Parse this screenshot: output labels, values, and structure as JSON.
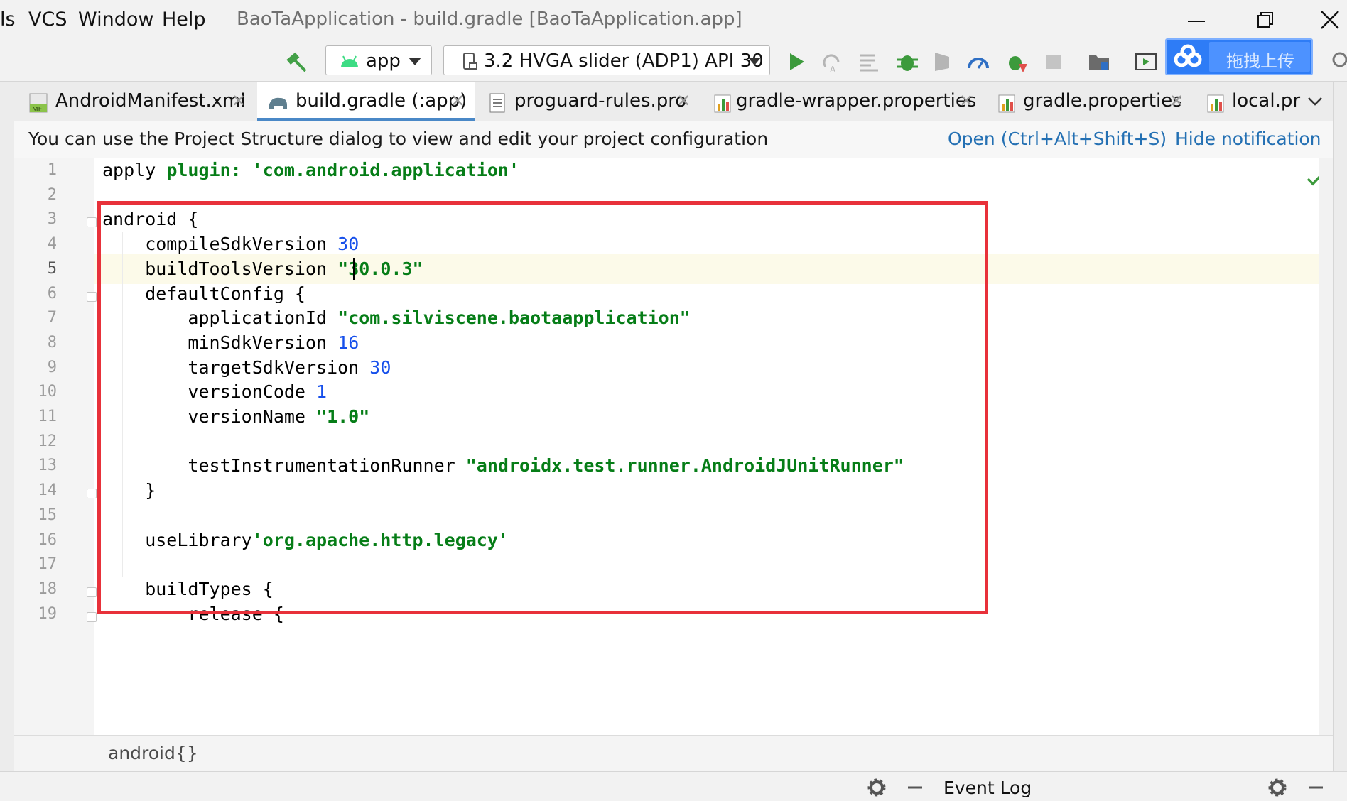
{
  "menu": {
    "items": [
      "ls",
      "VCS",
      "Window",
      "Help"
    ]
  },
  "window": {
    "title": "BaoTaApplication - build.gradle [BaoTaApplication.app]"
  },
  "toolbar": {
    "module_combo": "app",
    "device_combo": "3.2  HVGA slider (ADP1) API 30",
    "upload_button": "拖拽上传"
  },
  "tabs": [
    {
      "label": "AndroidManifest.xml",
      "active": false
    },
    {
      "label": "build.gradle (:app)",
      "active": true
    },
    {
      "label": "proguard-rules.pro",
      "active": false
    },
    {
      "label": "gradle-wrapper.properties",
      "active": false
    },
    {
      "label": "gradle.properties",
      "active": false
    },
    {
      "label": "local.pr",
      "active": false
    }
  ],
  "notification": {
    "message": "You can use the Project Structure dialog to view and edit your project configuration",
    "open_link": "Open (Ctrl+Alt+Shift+S)",
    "hide_link": "Hide notification"
  },
  "editor": {
    "line_numbers": [
      "1",
      "2",
      "3",
      "4",
      "5",
      "6",
      "7",
      "8",
      "9",
      "10",
      "11",
      "12",
      "13",
      "14",
      "15",
      "16",
      "17",
      "18",
      "19"
    ],
    "current_line": 5,
    "lines": [
      {
        "plain": "apply ",
        "key": "plugin: ",
        "str": "'com.android.application'"
      },
      {
        "plain": ""
      },
      {
        "plain": "android {"
      },
      {
        "plain": "    compileSdkVersion ",
        "num": "30"
      },
      {
        "plain": "    buildToolsVersion ",
        "str": "\"30.0.3\""
      },
      {
        "plain": "    defaultConfig {"
      },
      {
        "plain": "        applicationId ",
        "str": "\"com.silviscene.baotaapplication\""
      },
      {
        "plain": "        minSdkVersion ",
        "num": "16"
      },
      {
        "plain": "        targetSdkVersion ",
        "num": "30"
      },
      {
        "plain": "        versionCode ",
        "num": "1"
      },
      {
        "plain": "        versionName ",
        "str": "\"1.0\""
      },
      {
        "plain": ""
      },
      {
        "plain": "        testInstrumentationRunner ",
        "str": "\"androidx.test.runner.AndroidJUnitRunner\""
      },
      {
        "plain": "    }"
      },
      {
        "plain": ""
      },
      {
        "plain": "    useLibrary",
        "str": "'org.apache.http.legacy'"
      },
      {
        "plain": ""
      },
      {
        "plain": "    buildTypes {"
      },
      {
        "plain": "        release {"
      }
    ]
  },
  "breadcrumb": {
    "path": "android{}"
  },
  "statusbar": {
    "event_log": "Event Log"
  },
  "colors": {
    "accent": "#4a88c7",
    "highlight_box": "#e8313a",
    "link": "#2470b3"
  }
}
